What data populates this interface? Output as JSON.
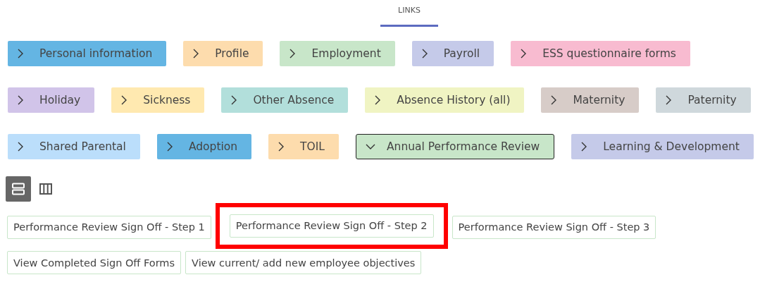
{
  "header": {
    "title": "LINKS"
  },
  "link_rows": [
    [
      {
        "label": "Personal information",
        "color": "#64b5e3",
        "expanded": false
      },
      {
        "label": "Profile",
        "color": "#fddcad",
        "expanded": false
      },
      {
        "label": "Employment",
        "color": "#c8e6c9",
        "expanded": false
      },
      {
        "label": "Payroll",
        "color": "#c5cae9",
        "expanded": false
      },
      {
        "label": "ESS questionnaire forms",
        "color": "#f8bbd0",
        "expanded": false
      }
    ],
    [
      {
        "label": "Holiday",
        "color": "#d1c4e9",
        "expanded": false
      },
      {
        "label": "Sickness",
        "color": "#ffe9b0",
        "expanded": false
      },
      {
        "label": "Other Absence",
        "color": "#b2dfdb",
        "expanded": false
      },
      {
        "label": "Absence History (all)",
        "color": "#f0f4c3",
        "expanded": false
      },
      {
        "label": "Maternity",
        "color": "#d7ccc8",
        "expanded": false
      },
      {
        "label": "Paternity",
        "color": "#cfd8dc",
        "expanded": false
      }
    ],
    [
      {
        "label": "Shared Parental",
        "color": "#bbdefb",
        "expanded": false
      },
      {
        "label": "Adoption",
        "color": "#64b5e3",
        "expanded": false
      },
      {
        "label": "TOIL",
        "color": "#fddcad",
        "expanded": false
      },
      {
        "label": "Annual Performance Review",
        "color": "#c8e6c9",
        "expanded": true
      },
      {
        "label": "Learning & Development",
        "color": "#c5cae9",
        "expanded": false
      }
    ]
  ],
  "view_toggles": [
    {
      "kind": "rows",
      "selected": true
    },
    {
      "kind": "columns",
      "selected": false
    }
  ],
  "sub_link_rows": [
    [
      {
        "label": "Performance Review Sign Off - Step 1",
        "highlighted": false
      },
      {
        "label": "Performance Review Sign Off - Step 2",
        "highlighted": true
      },
      {
        "label": "Performance Review Sign Off - Step 3",
        "highlighted": false
      }
    ],
    [
      {
        "label": "View Completed Sign Off Forms",
        "highlighted": false
      },
      {
        "label": "View current/ add new employee objectives",
        "highlighted": false
      }
    ]
  ]
}
